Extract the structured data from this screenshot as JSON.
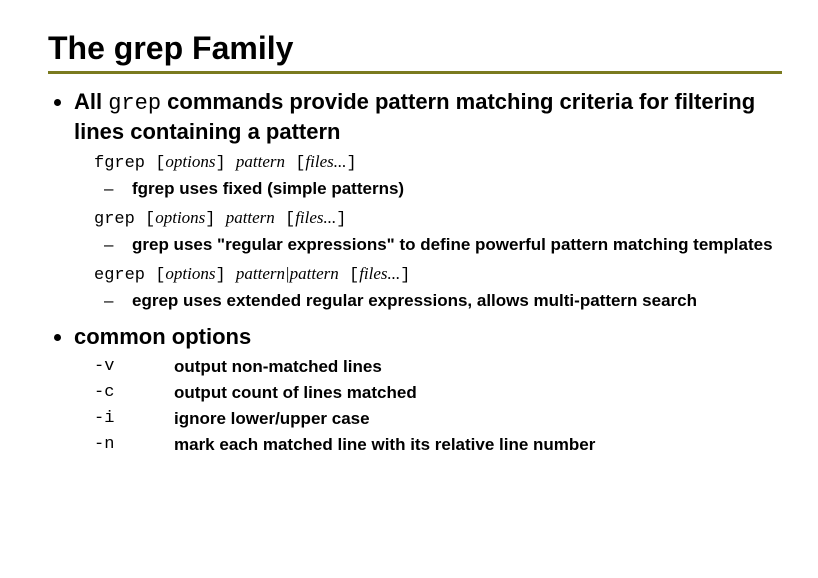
{
  "title": "The grep Family",
  "bullets": {
    "intro_pre": "All ",
    "intro_code": "grep",
    "intro_post": " commands provide pattern matching criteria for filtering lines containing a pattern",
    "common": "common options"
  },
  "cmds": {
    "fgrep": {
      "name": "fgrep",
      "opts_l": " [",
      "opts": "options",
      "opts_r": "] ",
      "pat": "pattern",
      "files_l": " [",
      "files": "files...",
      "files_r": "]",
      "desc": "fgrep uses fixed (simple patterns)"
    },
    "grep": {
      "name": "grep",
      "opts_l": " [",
      "opts": "options",
      "opts_r": "] ",
      "pat": "pattern",
      "files_l": " [",
      "files": "files...",
      "files_r": "]",
      "desc": "grep uses \"regular expressions\" to define powerful pattern matching templates"
    },
    "egrep": {
      "name": "egrep",
      "opts_l": " [",
      "opts": "options",
      "opts_r": "] ",
      "pat": "pattern|pattern",
      "files_l": " [",
      "files": "files...",
      "files_r": "]",
      "desc": "egrep uses extended regular expressions, allows multi-pattern search"
    }
  },
  "options": [
    {
      "flag": "-v",
      "desc": "output non-matched lines"
    },
    {
      "flag": "-c",
      "desc": "output count of lines matched"
    },
    {
      "flag": "-i",
      "desc": "ignore lower/upper case"
    },
    {
      "flag": "-n",
      "desc": "mark each matched line with its relative line number"
    }
  ]
}
